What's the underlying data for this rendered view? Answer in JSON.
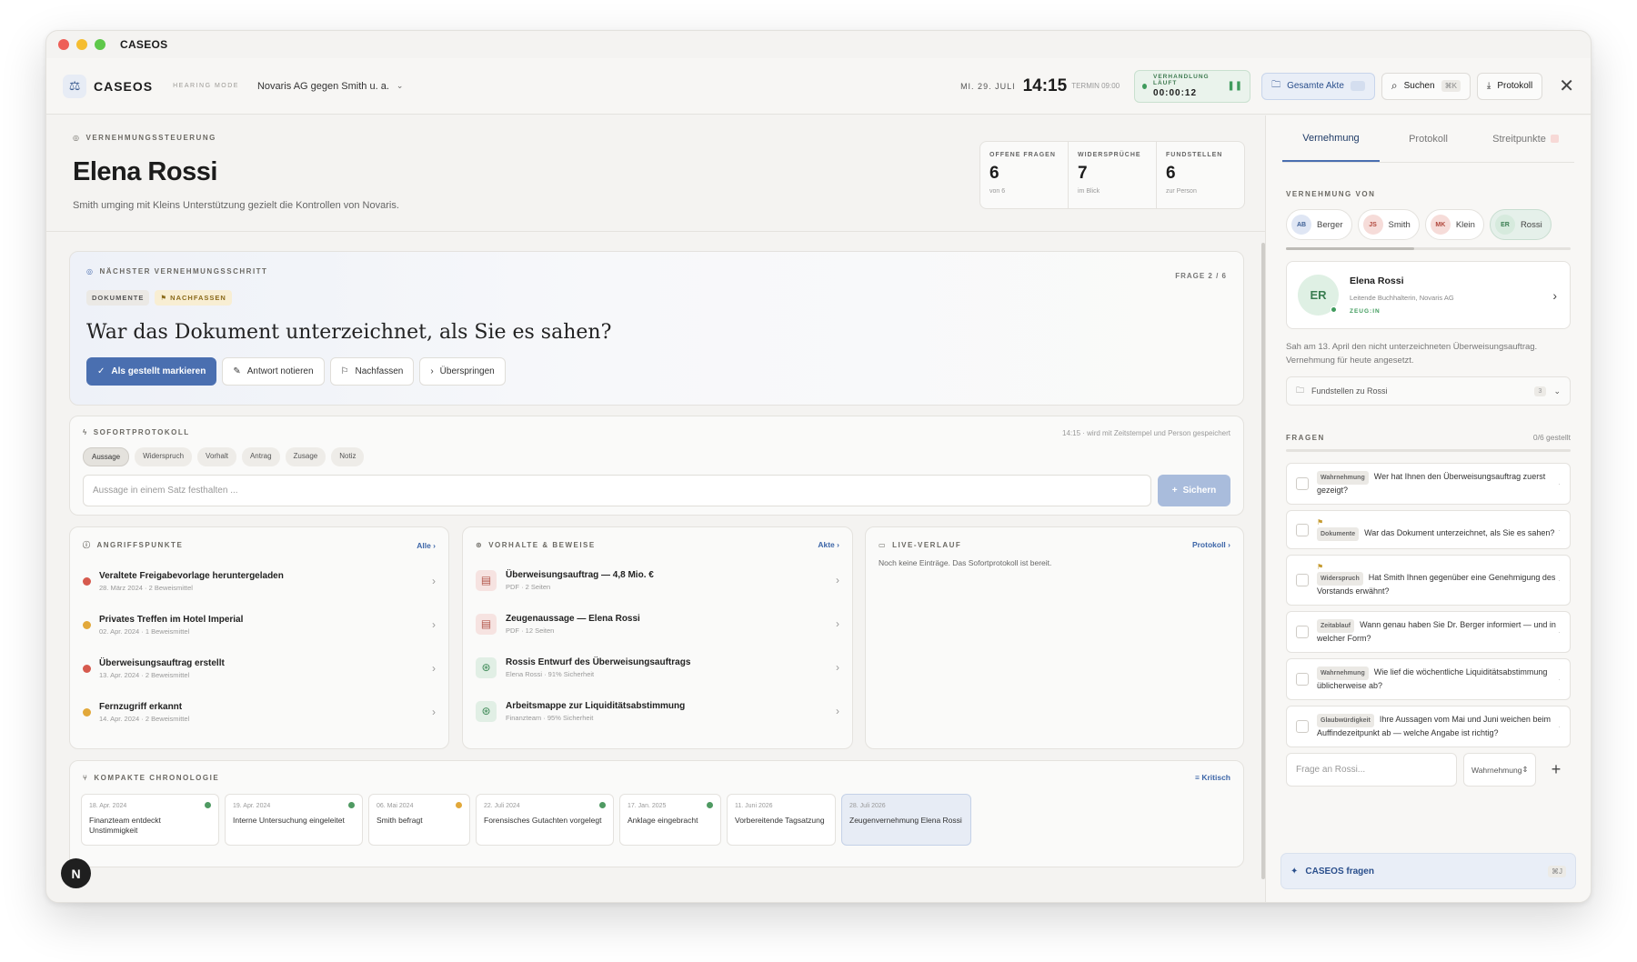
{
  "window": {
    "title": "CASEOS"
  },
  "topbar": {
    "brand": "CASEOS",
    "mode": "HEARING MODE",
    "case": "Novaris AG gegen Smith u. a.",
    "date": "MI. 29. JULI",
    "time": "14:15",
    "termin": "TERMIN 09:00",
    "live_label": "VERHANDLUNG LÄUFT",
    "live_timer": "00:00:12",
    "btn_akte": "Gesamte Akte",
    "btn_search": "Suchen",
    "search_kbd": "⌘K",
    "btn_protokoll": "Protokoll"
  },
  "header": {
    "eyebrow": "VERNEHMUNGSSTEUERUNG",
    "name": "Elena Rossi",
    "subtitle": "Smith umging mit Kleins Unterstützung gezielt die Kontrollen von Novaris."
  },
  "stats": [
    {
      "label": "OFFENE FRAGEN",
      "value": "6",
      "sub": "von 6"
    },
    {
      "label": "WIDERSPRÜCHE",
      "value": "7",
      "sub": "im Blick"
    },
    {
      "label": "FUNDSTELLEN",
      "value": "6",
      "sub": "zur Person"
    }
  ],
  "next_step": {
    "eyebrow": "NÄCHSTER VERNEHMUNGSSCHRITT",
    "counter": "FRAGE 2 / 6",
    "tag1": "DOKUMENTE",
    "tag2": "NACHFASSEN",
    "question": "War das Dokument unterzeichnet, als Sie es sahen?",
    "btn_mark": "Als gestellt markieren",
    "btn_note": "Antwort notieren",
    "btn_follow": "Nachfassen",
    "btn_skip": "Überspringen"
  },
  "protocol": {
    "eyebrow": "SOFORTPROTOKOLL",
    "meta": "14:15 · wird mit Zeitstempel und Person gespeichert",
    "chips": [
      "Aussage",
      "Widerspruch",
      "Vorhalt",
      "Antrag",
      "Zusage",
      "Notiz"
    ],
    "placeholder": "Aussage in einem Satz festhalten ...",
    "save": "Sichern"
  },
  "attack": {
    "title": "ANGRIFFSPUNKTE",
    "link": "Alle",
    "items": [
      {
        "title": "Veraltete Freigabevorlage heruntergeladen",
        "meta": "28. März 2024 · 2 Beweismittel",
        "color": "#d65a4e"
      },
      {
        "title": "Privates Treffen im Hotel Imperial",
        "meta": "02. Apr. 2024 · 1 Beweismittel",
        "color": "#e2a83a"
      },
      {
        "title": "Überweisungsauftrag erstellt",
        "meta": "13. Apr. 2024 · 2 Beweismittel",
        "color": "#d65a4e"
      },
      {
        "title": "Fernzugriff erkannt",
        "meta": "14. Apr. 2024 · 2 Beweismittel",
        "color": "#e2a83a"
      }
    ]
  },
  "evidence": {
    "title": "VORHALTE & BEWEISE",
    "link": "Akte",
    "items": [
      {
        "title": "Überweisungsauftrag — 4,8 Mio. €",
        "meta": "PDF · 2 Seiten",
        "icon": "pdf-icon"
      },
      {
        "title": "Zeugenaussage — Elena Rossi",
        "meta": "PDF · 12 Seiten",
        "icon": "pdf-icon"
      },
      {
        "title": "Rossis Entwurf des Überweisungsauftrags",
        "meta": "Elena Rossi · 91% Sicherheit",
        "icon": "fingerprint-icon"
      },
      {
        "title": "Arbeitsmappe zur Liquiditätsabstimmung",
        "meta": "Finanzteam · 95% Sicherheit",
        "icon": "fingerprint-icon"
      }
    ]
  },
  "live_log": {
    "title": "LIVE-VERLAUF",
    "link": "Protokoll",
    "empty": "Noch keine Einträge. Das Sofortprotokoll ist bereit."
  },
  "chronology": {
    "title": "KOMPAKTE CHRONOLOGIE",
    "filter": "Kritisch",
    "events": [
      {
        "date": "18. Apr. 2024",
        "name": "Finanzteam entdeckt Unstimmigkeit",
        "color": "#4f9a62"
      },
      {
        "date": "19. Apr. 2024",
        "name": "Interne Untersuchung eingeleitet",
        "color": "#4f9a62"
      },
      {
        "date": "06. Mai 2024",
        "name": "Smith befragt",
        "color": "#e2a83a"
      },
      {
        "date": "22. Juli 2024",
        "name": "Forensisches Gutachten vorgelegt",
        "color": "#4f9a62"
      },
      {
        "date": "17. Jan. 2025",
        "name": "Anklage eingebracht",
        "color": "#4f9a62"
      },
      {
        "date": "11. Juni 2026",
        "name": "Vorbereitende Tagsatzung",
        "color": ""
      },
      {
        "date": "28. Juli 2026",
        "name": "Zeugenvernehmung Elena Rossi",
        "color": ""
      }
    ]
  },
  "fab": "N",
  "sidebar": {
    "tabs": [
      "Vernehmung",
      "Protokoll",
      "Streitpunkte"
    ],
    "section_label": "VERNEHMUNG VON",
    "people": [
      {
        "initials": "AB",
        "name": "Berger",
        "bg": "#dfe6f4",
        "fg": "#3d5f95"
      },
      {
        "initials": "JS",
        "name": "Smith",
        "bg": "#f6dcd9",
        "fg": "#b0473c"
      },
      {
        "initials": "MK",
        "name": "Klein",
        "bg": "#f6dcd9",
        "fg": "#b0473c"
      },
      {
        "initials": "ER",
        "name": "Rossi",
        "bg": "#d6eadd",
        "fg": "#3a7d51"
      }
    ],
    "people_progress": 0.45,
    "person": {
      "initials": "ER",
      "name": "Elena Rossi",
      "role": "Leitende Buchhalterin, Novaris AG",
      "badge": "ZEUG:IN",
      "desc": "Sah am 13. April den nicht unterzeichneten Überweisungsauftrag. Vernehmung für heute angesetzt."
    },
    "fund_label": "Fundstellen zu Rossi",
    "fund_count": "3",
    "questions_label": "FRAGEN",
    "questions_count": "0/6 gestellt",
    "questions": [
      {
        "tag": "Wahrnehmung",
        "text": "Wer hat Ihnen den Überweisungsauftrag zuerst gezeigt?",
        "flag": false
      },
      {
        "tag": "Dokumente",
        "text": "War das Dokument unterzeichnet, als Sie es sahen?",
        "flag": true
      },
      {
        "tag": "Widerspruch",
        "text": "Hat Smith Ihnen gegenüber eine Genehmigung des Vorstands erwähnt?",
        "flag": true
      },
      {
        "tag": "Zeitablauf",
        "text": "Wann genau haben Sie Dr. Berger informiert — und in welcher Form?",
        "flag": false
      },
      {
        "tag": "Wahrnehmung",
        "text": "Wie lief die wöchentliche Liquiditätsabstimmung üblicherweise ab?",
        "flag": false
      },
      {
        "tag": "Glaubwürdigkeit",
        "text": "Ihre Aussagen vom Mai und Juni weichen beim Auffindezeitpunkt ab — welche Angabe ist richtig?",
        "flag": false
      }
    ],
    "ask_placeholder": "Frage an Rossi...",
    "ask_select": "Wahrnehmung",
    "caseos_ask": "CASEOS fragen",
    "caseos_kbd": "⌘J"
  }
}
